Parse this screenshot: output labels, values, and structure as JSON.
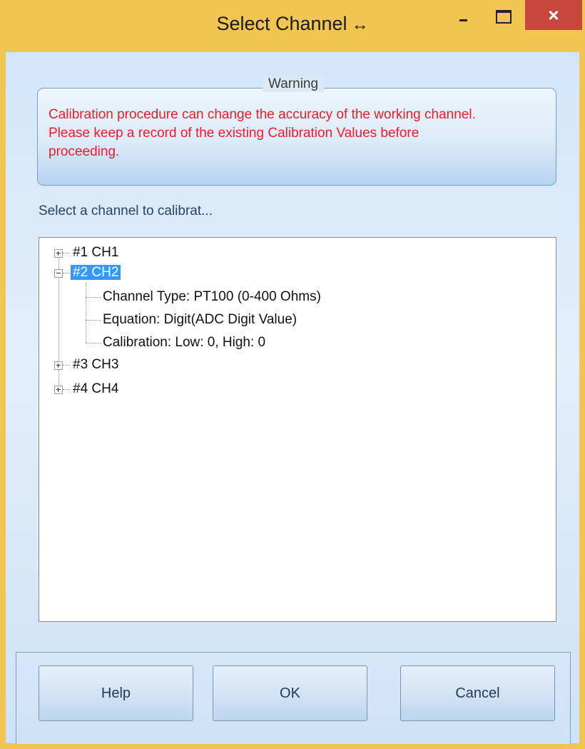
{
  "window": {
    "title": "Select Channel",
    "resize_glyph": "↔"
  },
  "titlebar_buttons": {
    "minimize_icon": "minimize-icon",
    "maximize_icon": "maximize-icon",
    "close_glyph": "×"
  },
  "warning": {
    "legend": "Warning",
    "lines": [
      "Calibration procedure can change the accuracy of the working channel.",
      "Please keep a record of the existing Calibration Values before",
      "proceeding."
    ],
    "color": "#f2192c"
  },
  "select_label": "Select a channel to calibrat...",
  "tree": {
    "nodes": [
      {
        "label": "#1 CH1",
        "expanded": false
      },
      {
        "label": "#2 CH2",
        "expanded": true,
        "selected": true,
        "children": [
          "Channel Type: PT100 (0-400 Ohms)",
          "Equation: Digit(ADC Digit Value)",
          "Calibration: Low: 0, High: 0"
        ]
      },
      {
        "label": "#3 CH3",
        "expanded": false
      },
      {
        "label": "#4 CH4",
        "expanded": false
      }
    ],
    "selection_color": "#3399ff"
  },
  "buttons": {
    "help": "Help",
    "ok": "OK",
    "cancel": "Cancel"
  },
  "colors": {
    "title_bar": "#f0c552",
    "close_button": "#c7473e",
    "client_background": "#d3e6f8"
  }
}
